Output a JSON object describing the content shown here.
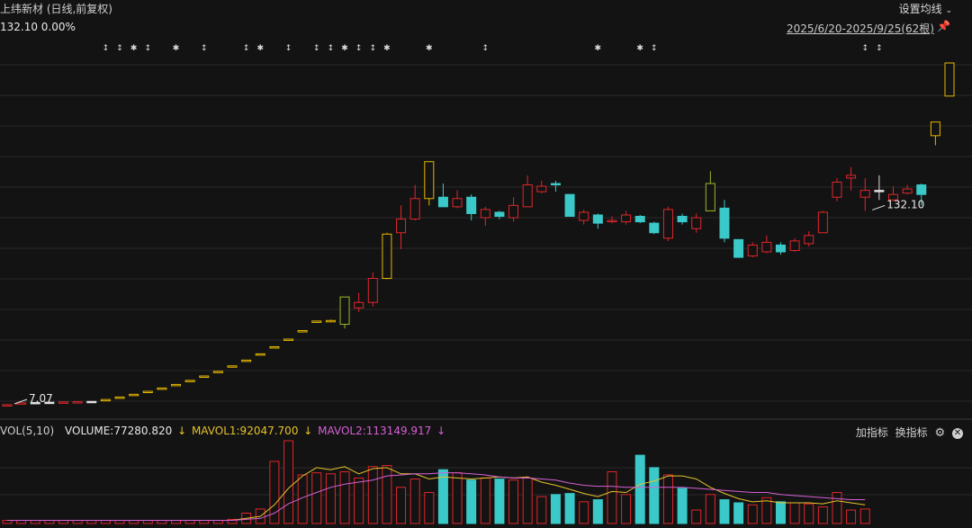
{
  "header": {
    "title": "上纬新材 (日线,前复权)",
    "settings_label": "设置均线",
    "price_info": "132.10 0.00%",
    "date_range": "2025/6/20-2025/9/25(62根)"
  },
  "volume_panel": {
    "label": "VOL(5,10)",
    "volume": "VOLUME:77280.820",
    "mavol1": "MAVOL1:92047.700",
    "mavol2": "MAVOL2:113149.917",
    "add_indicator": "加指标",
    "switch_indicator": "换指标"
  },
  "icons": {
    "settings_chevron": "chevron-down-icon",
    "pin": "pin-icon",
    "gear": "gear-icon",
    "close": "close-icon",
    "arrow": "arrow-down-icon"
  },
  "colors": {
    "up": "#e0262b",
    "down": "#3bc8c8",
    "limit": "#e6b800",
    "ma1": "#e6c229",
    "ma2": "#d660d6",
    "grid": "#2a2a2a"
  },
  "chart_data": {
    "type": "candlestick",
    "price_range": [
      7.07,
      132.1
    ],
    "annotations": [
      {
        "text": "132.10",
        "index": 61
      },
      {
        "text": "7.07",
        "index": 0
      }
    ],
    "candles": [
      {
        "o": 7.1,
        "c": 7.1,
        "h": 7.3,
        "l": 7.07,
        "d": "u"
      },
      {
        "o": 7.3,
        "c": 7.8,
        "h": 7.9,
        "l": 7.3,
        "d": "u"
      },
      {
        "o": 7.8,
        "c": 7.9,
        "h": 8.0,
        "l": 7.7,
        "d": "n"
      },
      {
        "o": 7.9,
        "c": 8.0,
        "h": 8.1,
        "l": 7.8,
        "d": "n"
      },
      {
        "o": 8.0,
        "c": 8.1,
        "h": 8.1,
        "l": 7.9,
        "d": "u"
      },
      {
        "o": 8.1,
        "c": 8.2,
        "h": 8.3,
        "l": 8.0,
        "d": "u"
      },
      {
        "o": 8.2,
        "c": 8.3,
        "h": 8.4,
        "l": 8.1,
        "d": "n"
      },
      {
        "o": 9.0,
        "c": 9.0,
        "h": 9.0,
        "l": 9.0,
        "d": "l"
      },
      {
        "o": 9.9,
        "c": 9.9,
        "h": 9.9,
        "l": 9.9,
        "d": "l"
      },
      {
        "o": 10.9,
        "c": 10.9,
        "h": 10.9,
        "l": 10.9,
        "d": "l"
      },
      {
        "o": 12.0,
        "c": 12.0,
        "h": 12.0,
        "l": 12.0,
        "d": "l"
      },
      {
        "o": 13.2,
        "c": 13.2,
        "h": 13.2,
        "l": 13.2,
        "d": "l"
      },
      {
        "o": 14.5,
        "c": 14.5,
        "h": 14.5,
        "l": 14.5,
        "d": "l"
      },
      {
        "o": 16.0,
        "c": 16.0,
        "h": 16.0,
        "l": 16.0,
        "d": "l"
      },
      {
        "o": 17.6,
        "c": 17.6,
        "h": 17.6,
        "l": 17.6,
        "d": "l"
      },
      {
        "o": 19.3,
        "c": 19.3,
        "h": 19.3,
        "l": 19.3,
        "d": "l"
      },
      {
        "o": 21.3,
        "c": 21.3,
        "h": 21.3,
        "l": 21.3,
        "d": "l"
      },
      {
        "o": 23.4,
        "c": 23.4,
        "h": 23.4,
        "l": 23.4,
        "d": "l"
      },
      {
        "o": 25.7,
        "c": 25.7,
        "h": 25.7,
        "l": 25.7,
        "d": "l"
      },
      {
        "o": 28.3,
        "c": 28.3,
        "h": 28.3,
        "l": 28.3,
        "d": "l"
      },
      {
        "o": 31.1,
        "c": 31.1,
        "h": 31.1,
        "l": 31.1,
        "d": "l"
      },
      {
        "o": 34.2,
        "c": 34.2,
        "h": 34.2,
        "l": 34.2,
        "d": "l"
      },
      {
        "o": 37.7,
        "c": 37.7,
        "h": 37.7,
        "l": 37.7,
        "d": "l"
      },
      {
        "o": 37.9,
        "c": 37.5,
        "h": 38.2,
        "l": 37.2,
        "d": "l"
      },
      {
        "o": 36.5,
        "c": 46.5,
        "h": 46.5,
        "l": 35.0,
        "d": "g"
      },
      {
        "o": 42.5,
        "c": 44.5,
        "h": 48.0,
        "l": 41.0,
        "d": "u"
      },
      {
        "o": 44.5,
        "c": 53.3,
        "h": 55.5,
        "l": 43.0,
        "d": "u"
      },
      {
        "o": 53.3,
        "c": 69.5,
        "h": 70.0,
        "l": 53.0,
        "d": "l"
      },
      {
        "o": 70.0,
        "c": 75.0,
        "h": 80.0,
        "l": 64.0,
        "d": "u"
      },
      {
        "o": 75.0,
        "c": 82.5,
        "h": 87.5,
        "l": 74.5,
        "d": "u"
      },
      {
        "o": 82.5,
        "c": 96.0,
        "h": 96.0,
        "l": 80.0,
        "d": "l"
      },
      {
        "o": 83.0,
        "c": 79.5,
        "h": 88.0,
        "l": 79.5,
        "d": "d"
      },
      {
        "o": 79.5,
        "c": 82.5,
        "h": 85.5,
        "l": 79.0,
        "d": "u"
      },
      {
        "o": 83.0,
        "c": 77.0,
        "h": 84.0,
        "l": 74.5,
        "d": "d"
      },
      {
        "o": 75.5,
        "c": 78.5,
        "h": 79.5,
        "l": 72.5,
        "d": "u"
      },
      {
        "o": 77.5,
        "c": 76.0,
        "h": 78.0,
        "l": 75.0,
        "d": "d"
      },
      {
        "o": 75.5,
        "c": 80.0,
        "h": 83.0,
        "l": 74.0,
        "d": "u"
      },
      {
        "o": 79.5,
        "c": 87.5,
        "h": 91.0,
        "l": 79.5,
        "d": "u"
      },
      {
        "o": 85.0,
        "c": 87.0,
        "h": 89.0,
        "l": 84.5,
        "d": "u"
      },
      {
        "o": 88.0,
        "c": 87.5,
        "h": 89.0,
        "l": 85.0,
        "d": "d"
      },
      {
        "o": 84.0,
        "c": 76.0,
        "h": 84.0,
        "l": 76.0,
        "d": "d"
      },
      {
        "o": 74.5,
        "c": 77.5,
        "h": 78.5,
        "l": 73.0,
        "d": "u"
      },
      {
        "o": 76.5,
        "c": 73.5,
        "h": 77.0,
        "l": 71.5,
        "d": "d"
      },
      {
        "o": 74.5,
        "c": 74.5,
        "h": 76.0,
        "l": 73.5,
        "d": "u"
      },
      {
        "o": 74.0,
        "c": 76.5,
        "h": 78.0,
        "l": 73.0,
        "d": "u"
      },
      {
        "o": 76.0,
        "c": 74.0,
        "h": 76.5,
        "l": 73.5,
        "d": "d"
      },
      {
        "o": 73.5,
        "c": 70.0,
        "h": 74.0,
        "l": 69.5,
        "d": "d"
      },
      {
        "o": 68.0,
        "c": 78.5,
        "h": 79.5,
        "l": 67.0,
        "d": "u"
      },
      {
        "o": 76.0,
        "c": 74.0,
        "h": 77.0,
        "l": 73.0,
        "d": "d"
      },
      {
        "o": 71.5,
        "c": 75.5,
        "h": 77.0,
        "l": 70.0,
        "d": "u"
      },
      {
        "o": 78.0,
        "c": 88.0,
        "h": 92.5,
        "l": 78.0,
        "d": "g"
      },
      {
        "o": 79.0,
        "c": 68.0,
        "h": 82.0,
        "l": 66.5,
        "d": "d"
      },
      {
        "o": 67.5,
        "c": 61.0,
        "h": 67.5,
        "l": 61.0,
        "d": "d"
      },
      {
        "o": 61.5,
        "c": 65.5,
        "h": 66.5,
        "l": 61.0,
        "d": "u"
      },
      {
        "o": 63.0,
        "c": 66.5,
        "h": 69.0,
        "l": 62.5,
        "d": "u"
      },
      {
        "o": 65.5,
        "c": 63.0,
        "h": 66.5,
        "l": 62.0,
        "d": "d"
      },
      {
        "o": 63.5,
        "c": 67.0,
        "h": 68.0,
        "l": 63.0,
        "d": "u"
      },
      {
        "o": 66.0,
        "c": 69.0,
        "h": 70.5,
        "l": 65.0,
        "d": "u"
      },
      {
        "o": 70.0,
        "c": 77.5,
        "h": 78.0,
        "l": 70.0,
        "d": "u"
      },
      {
        "o": 83.0,
        "c": 88.5,
        "h": 90.0,
        "l": 81.5,
        "d": "u"
      },
      {
        "o": 91.0,
        "c": 90.0,
        "h": 94.0,
        "l": 85.5,
        "d": "u"
      },
      {
        "o": 83.0,
        "c": 85.5,
        "h": 90.0,
        "l": 78.0,
        "d": "u"
      },
      {
        "o": 85.5,
        "c": 85.5,
        "h": 91.0,
        "l": 82.0,
        "d": "n"
      },
      {
        "o": 84.0,
        "c": 82.0,
        "h": 87.0,
        "l": 81.5,
        "d": "u"
      },
      {
        "o": 84.5,
        "c": 86.0,
        "h": 87.5,
        "l": 84.0,
        "d": "u"
      },
      {
        "o": 87.5,
        "c": 84.0,
        "h": 88.0,
        "l": 80.0,
        "d": "d"
      },
      {
        "o": 105.5,
        "c": 110.5,
        "h": 110.5,
        "l": 102.0,
        "d": "l"
      },
      {
        "o": 120.0,
        "c": 132.1,
        "h": 132.1,
        "l": 120.0,
        "d": "l"
      }
    ],
    "volume": [
      3,
      3,
      3,
      3,
      3,
      3,
      3,
      3,
      3,
      3,
      3,
      3,
      3,
      3,
      3,
      3,
      4,
      10,
      14,
      60,
      80,
      47,
      49,
      48,
      50,
      44,
      55,
      56,
      35,
      43,
      30,
      52,
      49,
      42,
      44,
      43,
      42,
      44,
      26,
      28,
      29,
      21,
      23,
      50,
      28,
      66,
      54,
      47,
      34,
      13,
      28,
      23,
      20,
      18,
      25,
      21,
      20,
      19,
      16,
      30,
      13,
      14
    ],
    "mavol1": [
      3,
      3,
      3,
      3,
      3,
      3,
      3,
      3,
      3,
      3,
      3,
      3,
      3,
      3,
      3,
      3,
      3,
      5,
      7,
      18,
      34,
      46,
      54,
      52,
      55,
      48,
      53,
      54,
      48,
      48,
      43,
      45,
      44,
      43,
      44,
      45,
      44,
      45,
      40,
      37,
      33,
      29,
      26,
      31,
      30,
      38,
      41,
      46,
      46,
      43,
      35,
      29,
      24,
      21,
      22,
      20,
      20,
      20,
      19,
      22,
      20,
      18
    ],
    "mavol2": [
      3,
      3,
      3,
      3,
      3,
      3,
      3,
      3,
      3,
      3,
      3,
      3,
      3,
      3,
      3,
      3,
      3,
      4,
      5,
      10,
      19,
      25,
      30,
      35,
      38,
      40,
      42,
      46,
      47,
      48,
      48,
      49,
      49,
      48,
      47,
      45,
      44,
      44,
      43,
      42,
      39,
      37,
      36,
      36,
      35,
      35,
      35,
      35,
      35,
      34,
      33,
      32,
      31,
      30,
      30,
      28,
      27,
      26,
      25,
      24,
      23,
      23
    ]
  }
}
